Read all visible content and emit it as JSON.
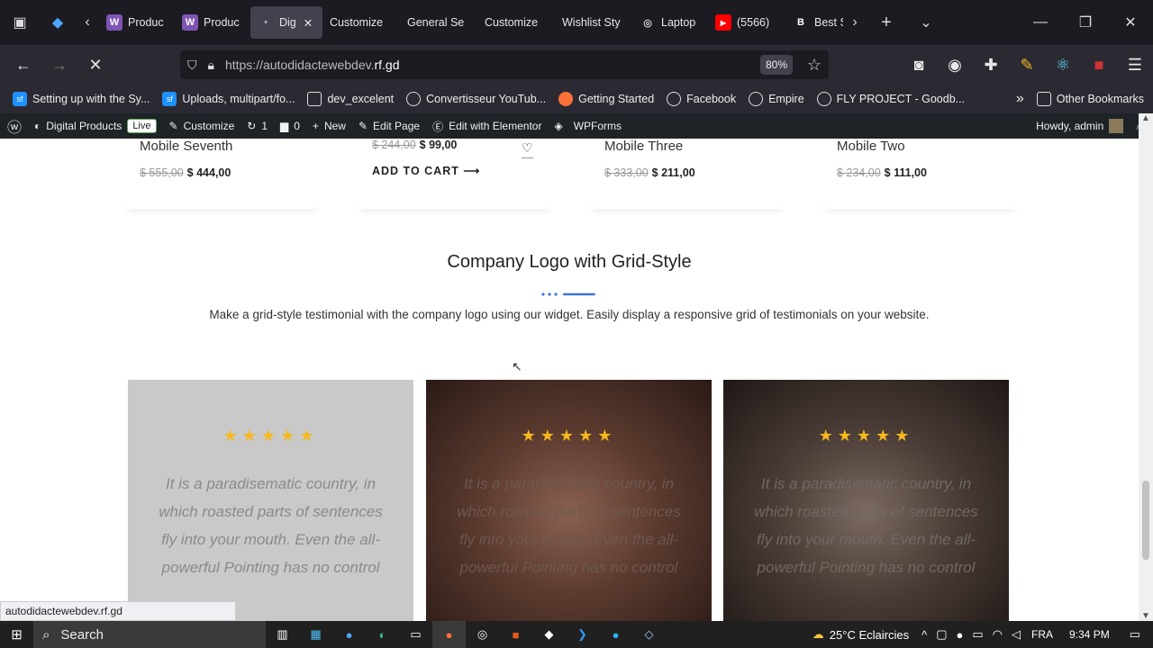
{
  "browser": {
    "tabs": [
      {
        "label": "Produc",
        "icon": "woo-icon"
      },
      {
        "label": "Produc",
        "icon": "woo-icon"
      },
      {
        "label": "Dig",
        "icon": "loading-dot-icon",
        "active": true
      },
      {
        "label": "Customize",
        "icon": ""
      },
      {
        "label": "General Se",
        "icon": ""
      },
      {
        "label": "Customize",
        "icon": ""
      },
      {
        "label": "Wishlist Sty",
        "icon": ""
      },
      {
        "label": "Laptop",
        "icon": "globe-icon"
      },
      {
        "label": "(5566)",
        "icon": "youtube-icon"
      },
      {
        "label": "Best S",
        "icon": "b-icon"
      }
    ],
    "url_scheme": "https://autodidactewebdev.",
    "url_domain": "rf.gd",
    "zoom": "80%",
    "bookmarks": [
      "Setting up with the Sy...",
      "Uploads, multipart/fo...",
      "dev_excelent",
      "Convertisseur YouTub...",
      "Getting Started",
      "Facebook",
      "Empire",
      "FLY PROJECT - Goodb..."
    ],
    "other_bookmarks": "Other Bookmarks"
  },
  "wp_admin": {
    "site": "Digital Products",
    "live": "Live",
    "customize": "Customize",
    "updates": "1",
    "comments": "0",
    "new": "New",
    "edit_page": "Edit Page",
    "elementor": "Edit with Elementor",
    "wpforms": "WPForms",
    "howdy": "Howdy, admin"
  },
  "products": [
    {
      "name": "Mobile Seventh",
      "old": "$ 555,00",
      "price": "$ 444,00"
    },
    {
      "name": "",
      "old": "$ 244,00",
      "price": "$ 99,00",
      "cart": "ADD TO CART"
    },
    {
      "name": "Mobile Three",
      "old": "$ 333,00",
      "price": "$ 211,00"
    },
    {
      "name": "Mobile Two",
      "old": "$ 234,00",
      "price": "$ 111,00"
    }
  ],
  "section": {
    "title": "Company Logo with Grid-Style",
    "description": "Make a grid-style testimonial with the company logo using our widget. Easily display a responsive grid of testimonials on your website.",
    "accent": "#3b74d9"
  },
  "testimonials": [
    {
      "stars": "★★★★★",
      "quote": "It is a paradisematic country, in which roasted parts of sentences fly into your mouth. Even the all-powerful Pointing has no control"
    },
    {
      "stars": "★★★★★",
      "quote": "It is a paradisematic country, in which roasted parts of sentences fly into your mouth. Even the all-powerful Pointing has no control"
    },
    {
      "stars": "★★★★★",
      "quote": "It is a paradisematic country, in which roasted parts of sentences fly into your mouth. Even the all-powerful Pointing has no control"
    }
  ],
  "status_url": "autodidactewebdev.rf.gd",
  "taskbar": {
    "search": "Search",
    "weather": "25°C  Eclaircies",
    "lang": "FRA",
    "time": "9:34 PM"
  }
}
